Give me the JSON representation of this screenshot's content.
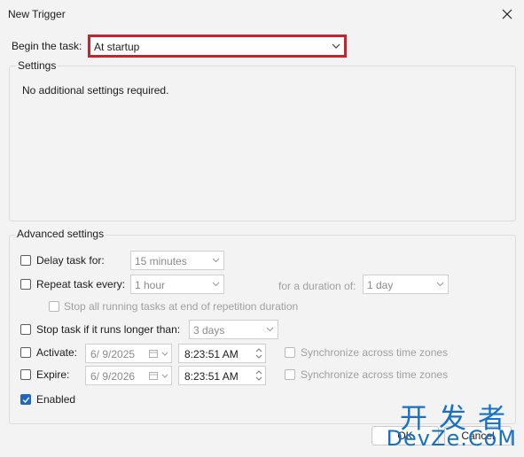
{
  "window": {
    "title": "New Trigger"
  },
  "begin": {
    "label": "Begin the task:",
    "value": "At startup"
  },
  "settings": {
    "legend": "Settings",
    "message": "No additional settings required."
  },
  "advanced": {
    "legend": "Advanced settings",
    "delay": {
      "label": "Delay task for:",
      "checked": false,
      "value": "15 minutes"
    },
    "repeat": {
      "label": "Repeat task every:",
      "checked": false,
      "value": "1 hour",
      "duration_label": "for a duration of:",
      "duration_value": "1 day",
      "stop_all_label": "Stop all running tasks at end of repetition duration"
    },
    "stop_longer": {
      "label": "Stop task if it runs longer than:",
      "checked": false,
      "value": "3 days"
    },
    "activate": {
      "label": "Activate:",
      "checked": false,
      "date": "6/ 9/2025",
      "time": "8:23:51 AM",
      "sync_label": "Synchronize across time zones"
    },
    "expire": {
      "label": "Expire:",
      "checked": false,
      "date": "6/ 9/2026",
      "time": "8:23:51 AM",
      "sync_label": "Synchronize across time zones"
    },
    "enabled": {
      "label": "Enabled",
      "checked": true
    }
  },
  "buttons": {
    "ok": "OK",
    "cancel": "Cancel"
  },
  "watermark": {
    "chinese": "开发者",
    "latin": "DevZe.CoM"
  },
  "colors": {
    "highlight": "#c8232c",
    "accent": "#1f66c2",
    "watermark": "#1670c9"
  }
}
